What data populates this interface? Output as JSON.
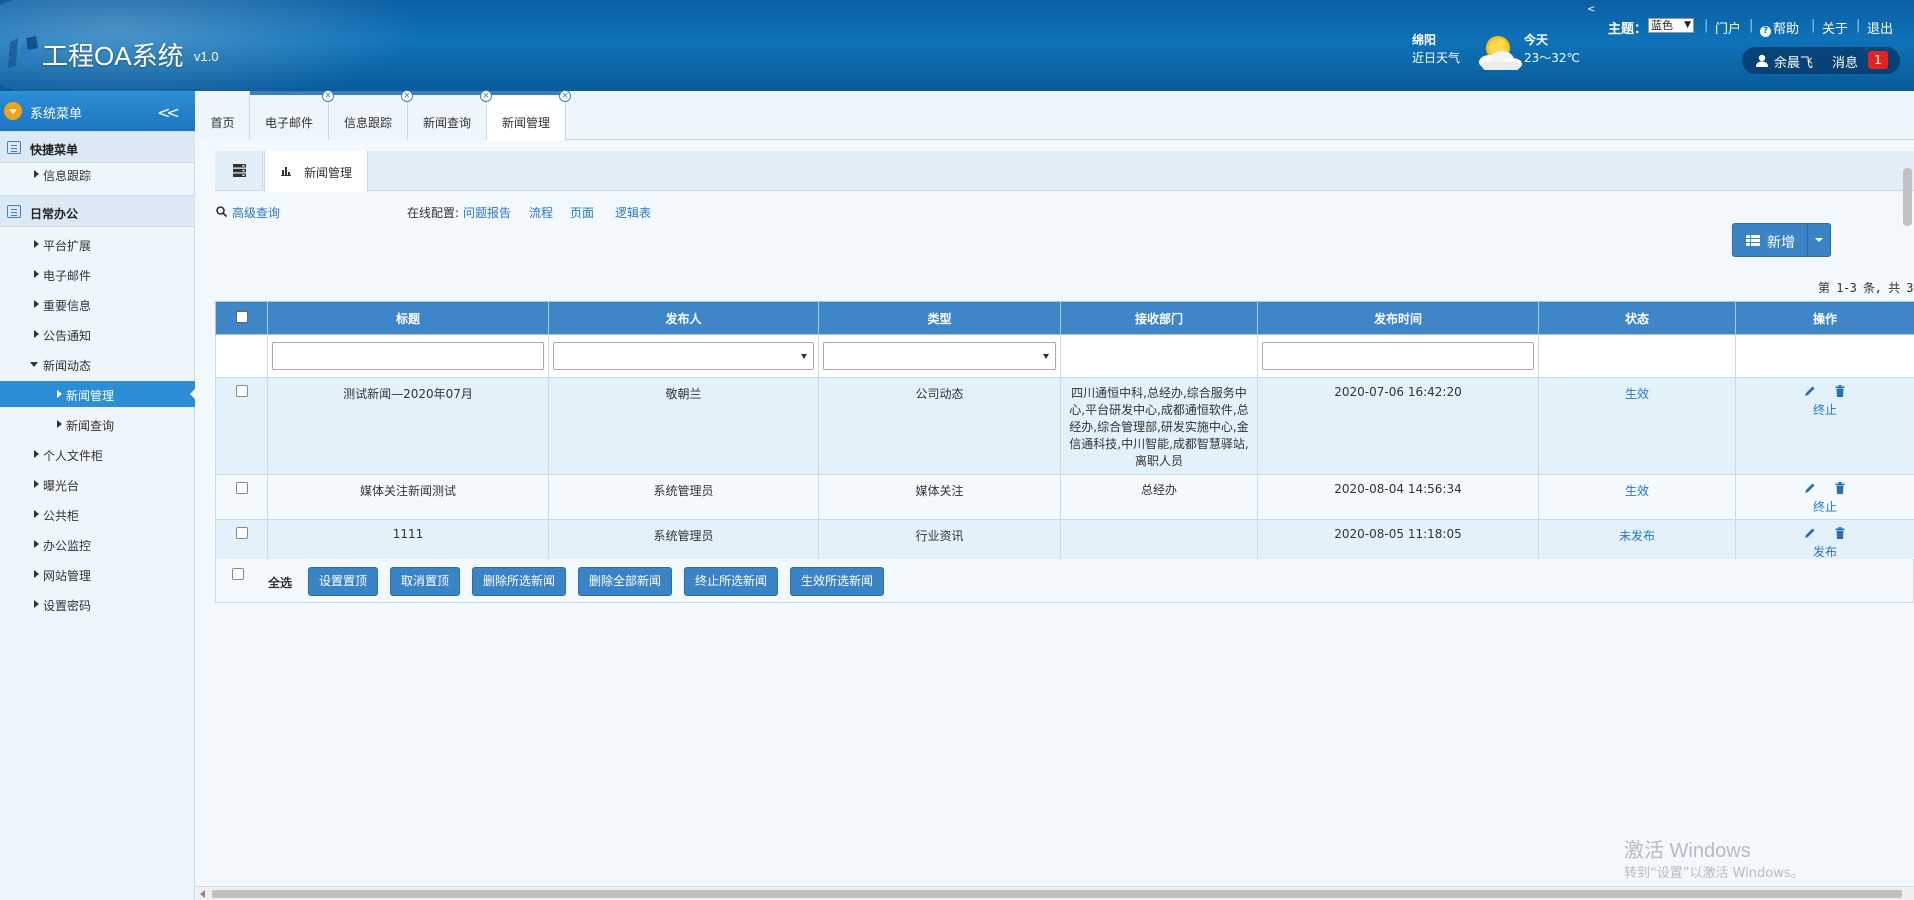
{
  "app": {
    "title": "工程OA系统",
    "version": "v1.0"
  },
  "weather": {
    "city": "绵阳",
    "label": "近日天气",
    "day": "今天",
    "temp": "23～32℃",
    "icon": "sun-cloud-icon"
  },
  "topnav": {
    "theme_label": "主题：",
    "theme_value": "蓝色",
    "portal": "门户",
    "help": "帮助",
    "about": "关于",
    "logout": "退出",
    "arrow": "<"
  },
  "user": {
    "name": "余晨飞",
    "msg_label": "消息",
    "msg_count": "1"
  },
  "sidebar": {
    "title": "系统菜单",
    "groups": [
      {
        "label": "快捷菜单",
        "items": [
          {
            "label": "信息跟踪"
          }
        ]
      },
      {
        "label": "日常办公",
        "items": [
          {
            "label": "平台扩展"
          },
          {
            "label": "电子邮件"
          },
          {
            "label": "重要信息"
          },
          {
            "label": "公告通知"
          },
          {
            "label": "新闻动态"
          },
          {
            "label": "新闻管理"
          },
          {
            "label": "新闻查询"
          },
          {
            "label": "个人文件柜"
          },
          {
            "label": "曝光台"
          },
          {
            "label": "公共柜"
          },
          {
            "label": "办公监控"
          },
          {
            "label": "网站管理"
          },
          {
            "label": "设置密码"
          }
        ]
      }
    ]
  },
  "tabs": [
    {
      "label": "首页"
    },
    {
      "label": "电子邮件"
    },
    {
      "label": "信息跟踪"
    },
    {
      "label": "新闻查询"
    },
    {
      "label": "新闻管理"
    }
  ],
  "subtab": {
    "label": "新闻管理"
  },
  "toolbar": {
    "advanced_search": "高级查询",
    "config_label": "在线配置:",
    "config_links": [
      "问题报告",
      "流程",
      "页面",
      "逻辑表"
    ],
    "add_label": "新增"
  },
  "pager": {
    "text": "第 1-3 条, 共 3"
  },
  "table": {
    "headers": [
      "标题",
      "发布人",
      "类型",
      "接收部门",
      "发布时间",
      "状态",
      "操作"
    ],
    "rows": [
      {
        "title": "测试新闻—2020年07月",
        "publisher": "敬朝兰",
        "type": "公司动态",
        "dept": "四川通恒中科,总经办,综合服务中心,平台研发中心,成都通恒软件,总经办,综合管理部,研发实施中心,金信通科技,中川智能,成都智慧驿站,离职人员",
        "time": "2020-07-06 16:42:20",
        "status": "生效",
        "action": "终止"
      },
      {
        "title": "媒体关注新闻测试",
        "publisher": "系统管理员",
        "type": "媒体关注",
        "dept": "总经办",
        "time": "2020-08-04 14:56:34",
        "status": "生效",
        "action": "终止"
      },
      {
        "title": "1111",
        "publisher": "系统管理员",
        "type": "行业资讯",
        "dept": "",
        "time": "2020-08-05 11:18:05",
        "status": "未发布",
        "action": "发布"
      }
    ]
  },
  "bulk": {
    "select_all": "全选",
    "buttons": [
      "设置置顶",
      "取消置顶",
      "删除所选新闻",
      "删除全部新闻",
      "终止所选新闻",
      "生效所选新闻"
    ]
  },
  "watermark": {
    "line1": "激活 Windows",
    "line2": "转到“设置”以激活 Windows。"
  }
}
